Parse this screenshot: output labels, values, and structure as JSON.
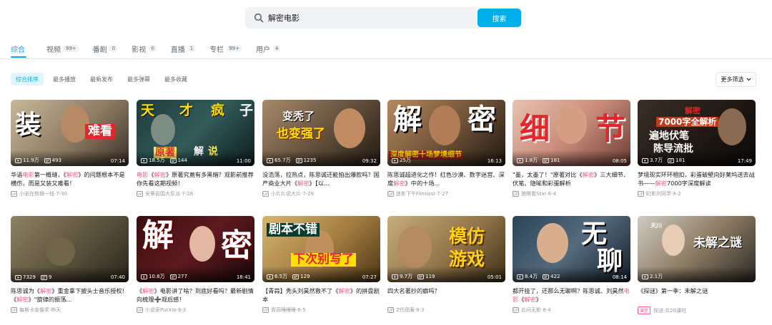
{
  "search": {
    "query": "解密电影",
    "button_label": "搜索"
  },
  "tabs": [
    {
      "label": "综合",
      "count": ""
    },
    {
      "label": "视频",
      "count": "99+"
    },
    {
      "label": "番剧",
      "count": "0"
    },
    {
      "label": "影视",
      "count": "0"
    },
    {
      "label": "直播",
      "count": "1"
    },
    {
      "label": "专栏",
      "count": "99+"
    },
    {
      "label": "用户",
      "count": "4"
    }
  ],
  "sorts": [
    "综合排序",
    "最多播放",
    "最新发布",
    "最多弹幕",
    "最多收藏"
  ],
  "more_filter_label": "更多筛选",
  "videos": [
    {
      "overlay": [
        "装",
        "难看"
      ],
      "plays": "11.9万",
      "danmaku": "493",
      "duration": "07:14",
      "title_parts": [
        "华语",
        "电影",
        "第一概缝，《",
        "解密",
        "》的问题根本不是横伤，而是又装又难看！"
      ],
      "author": "小张在剪辑一线",
      "date": "7-30"
    },
    {
      "overlay": [
        "天",
        "才",
        "疯",
        "子",
        "原著",
        "解",
        "说"
      ],
      "plays": "18.5万",
      "danmaku": "144",
      "duration": "11:00",
      "title_parts": [
        "",
        "电影",
        "《",
        "解密",
        "》原著究竟有多黑暗？观影前推荐你先看这期视频！"
      ],
      "author": "安蒂岩围大反派",
      "date": "7-28"
    },
    {
      "overlay": [
        "变秃了",
        "也变强了"
      ],
      "plays": "65.7万",
      "danmaku": "1235",
      "duration": "09:32",
      "title_parts": [
        "",
        "",
        "没浩荡，拉热点，陈思诚还能拍出爆款吗？国产商业大片《",
        "解密",
        "》【以..."
      ],
      "author": "小片片说大片",
      "date": "7-29"
    },
    {
      "overlay": [
        "解",
        "密",
        "深度解密十场梦境细节"
      ],
      "plays": "25万",
      "danmaku": "",
      "duration": "16:13",
      "title_parts": [
        "",
        "",
        "陈思诚超进化之作！红色沙漠、数字迷宫、深度",
        "解密",
        "》中的十场..."
      ],
      "author": "迷影下午Filmlast",
      "date": "7-27"
    },
    {
      "overlay": [
        "细",
        "节"
      ],
      "plays": "1.8万",
      "danmaku": "181",
      "duration": "08:05",
      "title_parts": [
        "",
        "",
        "\"墨，太墨了！\"原著对比《",
        "解密",
        "》三大细节、伏笔、隐喻和彩蛋解析"
      ],
      "author": "狼眼看Star",
      "date": "8-4"
    },
    {
      "overlay": [
        "解密",
        "7000字全解析",
        "遍地伏笔",
        "陈导流批"
      ],
      "plays": "3.7万",
      "danmaku": "181",
      "duration": "17:49",
      "title_parts": [
        "",
        "",
        "梦境现实环环相扣，彩蛋破壁向好莱坞送去战书——",
        "解密",
        "7000字深度解读"
      ],
      "author": "町影刘同学",
      "date": "8-2"
    },
    {
      "overlay": [],
      "plays": "7329",
      "danmaku": "9",
      "duration": "07:40",
      "title_parts": [
        "",
        "",
        "陈思诚为《",
        "解密",
        "》重金拿下披头士音乐授权!《",
        "解密",
        "》\"旋律的振荡..."
      ],
      "author": "每斯卡金像奖",
      "date": "昨天"
    },
    {
      "overlay": [
        "解",
        "密"
      ],
      "plays": "10.8万",
      "danmaku": "277",
      "duration": "18:41",
      "title_parts": [
        "",
        "",
        "《",
        "解密",
        "》电影讲了啥？到底好看吗？最新剧情向梳理➕观后感！"
      ],
      "author": "小说家Puckio",
      "date": "8-3"
    },
    {
      "overlay": [
        "剧本不错",
        "下次别写了"
      ],
      "plays": "6.5万",
      "danmaku": "129",
      "duration": "07:27",
      "title_parts": [
        "",
        "",
        "【青蒜】秃头刘昊然救不了《",
        "解密",
        "》的拼盘剧本"
      ],
      "author": "青蒜睡睡睡",
      "date": "8-5"
    },
    {
      "overlay": [
        "模仿",
        "游戏"
      ],
      "plays": "9.7万",
      "danmaku": "119",
      "duration": "05:01",
      "title_parts": [
        "",
        "",
        "四大名著抄的癖吗？",
        "",
        ""
      ],
      "author": "Z代观庵",
      "date": "8-3"
    },
    {
      "overlay": [
        "无",
        "聊"
      ],
      "plays": "8.4万",
      "danmaku": "422",
      "duration": "08:14",
      "title_parts": [
        "",
        "",
        "都开挂了，还那么无聊啊？陈思诚、刘昊然",
        "电影",
        "《",
        "解密",
        "》"
      ],
      "author": "此间无影",
      "date": "8-4"
    },
    {
      "overlay": [
        "未解之谜",
        "天川"
      ],
      "plays": "2.1万",
      "danmaku": "",
      "duration": "",
      "title_parts": [
        "",
        "",
        "《探谜》第一季：未解之谜",
        "",
        ""
      ],
      "author": "探谜",
      "date": "共20课时",
      "badge": "课堂"
    }
  ]
}
